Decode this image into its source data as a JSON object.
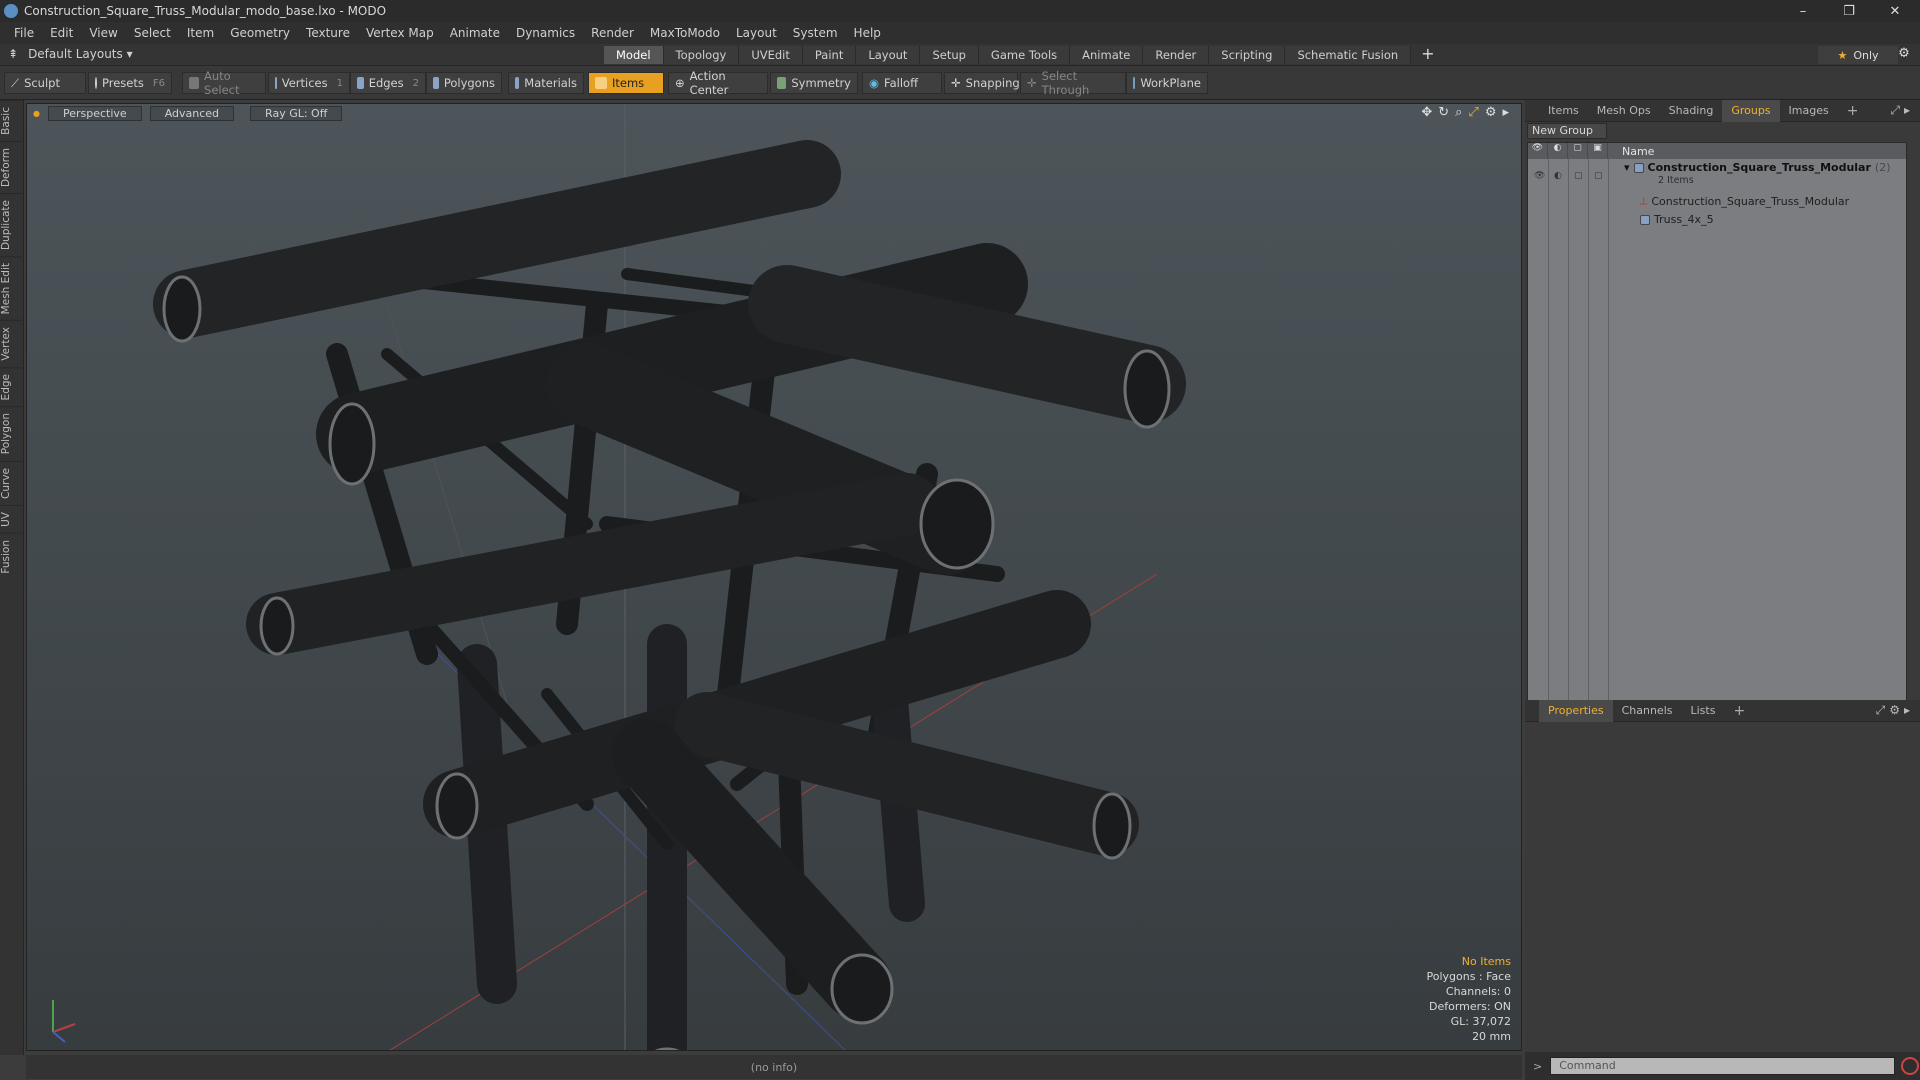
{
  "window": {
    "title": "Construction_Square_Truss_Modular_modo_base.lxo - MODO",
    "minimize": "–",
    "restore": "❐",
    "close": "✕"
  },
  "menu": [
    "File",
    "Edit",
    "View",
    "Select",
    "Item",
    "Geometry",
    "Texture",
    "Vertex Map",
    "Animate",
    "Dynamics",
    "Render",
    "MaxToModo",
    "Layout",
    "System",
    "Help"
  ],
  "layout": {
    "preset": "Default Layouts",
    "tabs": [
      "Model",
      "Topology",
      "UVEdit",
      "Paint",
      "Layout",
      "Setup",
      "Game Tools",
      "Animate",
      "Render",
      "Scripting",
      "Schematic Fusion"
    ],
    "active_tab": "Model",
    "plus": "+",
    "only_label": "Only"
  },
  "toolbar": {
    "sculpt": "Sculpt",
    "presets": "Presets",
    "presets_key": "F6",
    "auto_select": "Auto Select",
    "vertices": "Vertices",
    "vertices_count": "1",
    "edges": "Edges",
    "edges_count": "2",
    "polygons": "Polygons",
    "materials": "Materials",
    "items": "Items",
    "action_center": "Action Center",
    "symmetry": "Symmetry",
    "falloff": "Falloff",
    "snapping": "Snapping",
    "select_through": "Select Through",
    "workplane": "WorkPlane"
  },
  "left_tabs": [
    "Basic",
    "Deform",
    "Duplicate",
    "Mesh Edit",
    "Vertex",
    "Edge",
    "Polygon",
    "Curve",
    "UV",
    "Fusion"
  ],
  "viewport": {
    "view_mode": "Perspective",
    "shading": "Advanced",
    "raygl": "Ray GL: Off",
    "stats": {
      "selection": "No Items",
      "polygons": "Polygons : Face",
      "channels": "Channels: 0",
      "deformers": "Deformers: ON",
      "gl": "GL: 37,072",
      "unit": "20 mm"
    }
  },
  "status": "(no info)",
  "panel_tabs": [
    "Items",
    "Mesh Ops",
    "Shading",
    "Groups",
    "Images"
  ],
  "panel_active": "Groups",
  "groups": {
    "new_group": "New Group",
    "name_header": "Name",
    "root": {
      "name": "Construction_Square_Truss_Modular",
      "count": "(2)",
      "items_label": "2 Items"
    },
    "children": [
      {
        "name": "Construction_Square_Truss_Modular",
        "icon": "locator-icon"
      },
      {
        "name": "Truss_4x_5",
        "icon": "mesh-icon"
      }
    ]
  },
  "bottom_tabs": [
    "Properties",
    "Channels",
    "Lists"
  ],
  "bottom_active": "Properties",
  "command": {
    "placeholder": "Command",
    "prompt": ">"
  }
}
